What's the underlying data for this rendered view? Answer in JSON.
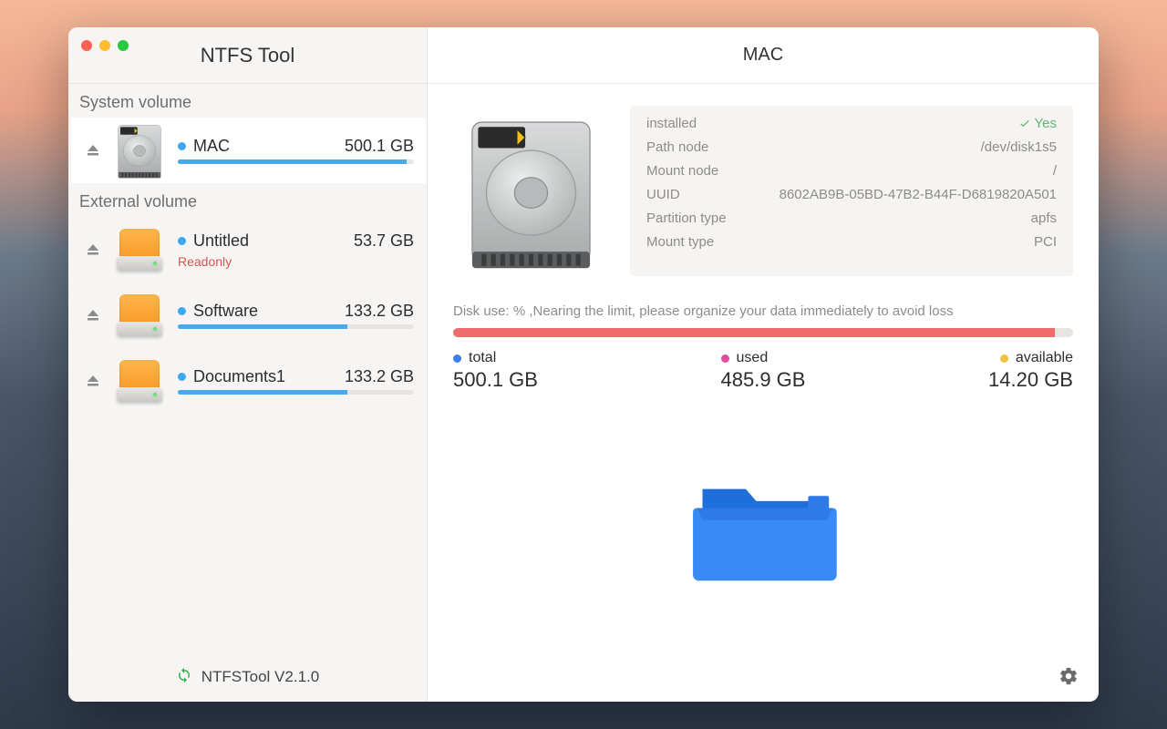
{
  "app_title": "NTFS Tool",
  "main_title": "MAC",
  "sections": {
    "system_label": "System volume",
    "external_label": "External volume"
  },
  "volumes": {
    "system": [
      {
        "name": "MAC",
        "size": "500.1 GB",
        "fill_pct": 97,
        "selected": true
      }
    ],
    "external": [
      {
        "name": "Untitled",
        "size": "53.7 GB",
        "fill_pct": 0,
        "status": "Readonly"
      },
      {
        "name": "Software",
        "size": "133.2 GB",
        "fill_pct": 72
      },
      {
        "name": "Documents1",
        "size": "133.2 GB",
        "fill_pct": 72
      }
    ]
  },
  "footer_version": "NTFSTool V2.1.0",
  "details": {
    "rows": [
      {
        "label": "installed",
        "value": "Yes",
        "yes": true
      },
      {
        "label": "Path node",
        "value": "/dev/disk1s5"
      },
      {
        "label": "Mount node",
        "value": "/"
      },
      {
        "label": "UUID",
        "value": "8602AB9B-05BD-47B2-B44F-D6819820A501"
      },
      {
        "label": "Partition type",
        "value": "apfs"
      },
      {
        "label": "Mount type",
        "value": "PCI"
      }
    ]
  },
  "usage": {
    "label": "Disk use: % ,Nearing the limit, please organize your data immediately to avoid loss",
    "fill_pct": 97
  },
  "stats": {
    "total": {
      "label": "total",
      "value": "500.1 GB"
    },
    "used": {
      "label": "used",
      "value": "485.9 GB"
    },
    "available": {
      "label": "available",
      "value": "14.20 GB"
    }
  }
}
